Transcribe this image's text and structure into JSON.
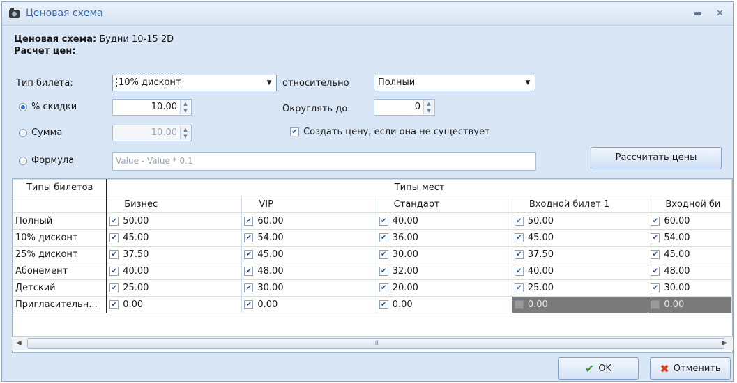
{
  "window": {
    "title": "Ценовая схема"
  },
  "scheme": {
    "label": "Ценовая схема:",
    "value": "Будни 10-15 2D"
  },
  "calc": {
    "title": "Расчет цен:",
    "ticket_type_label": "Тип билета:",
    "ticket_type_value": "10% дисконт",
    "relative_label": "относительно",
    "relative_value": "Полный",
    "discount_label": "% скидки",
    "discount_value": "10.00",
    "round_label": "Округлять до:",
    "round_value": "0",
    "sum_label": "Сумма",
    "sum_value": "10.00",
    "create_price_label": "Создать цену, если она не существует",
    "formula_label": "Формула",
    "formula_value": "Value - Value * 0.1",
    "calc_button": "Рассчитать цены"
  },
  "grid": {
    "ticket_types_header": "Типы билетов",
    "seat_types_header": "Типы мест",
    "columns": [
      "Бизнес",
      "VIP",
      "Стандарт",
      "Входной билет 1",
      "Входной би"
    ],
    "rows": [
      {
        "name": "Полный",
        "values": [
          "50.00",
          "60.00",
          "40.00",
          "50.00",
          "60.00"
        ]
      },
      {
        "name": "10% дисконт",
        "values": [
          "45.00",
          "54.00",
          "36.00",
          "45.00",
          "54.00"
        ]
      },
      {
        "name": "25% дисконт",
        "values": [
          "37.50",
          "45.00",
          "30.00",
          "37.50",
          "45.00"
        ]
      },
      {
        "name": "Абонемент",
        "values": [
          "40.00",
          "48.00",
          "32.00",
          "40.00",
          "48.00"
        ]
      },
      {
        "name": "Детский",
        "values": [
          "25.00",
          "30.00",
          "20.00",
          "25.00",
          "30.00"
        ]
      },
      {
        "name": "Пригласительн...",
        "values": [
          "0.00",
          "0.00",
          "0.00",
          "0.00",
          "0.00"
        ]
      }
    ],
    "scroll_thumb_grip": "III"
  },
  "buttons": {
    "ok": "OK",
    "cancel": "Отменить"
  }
}
